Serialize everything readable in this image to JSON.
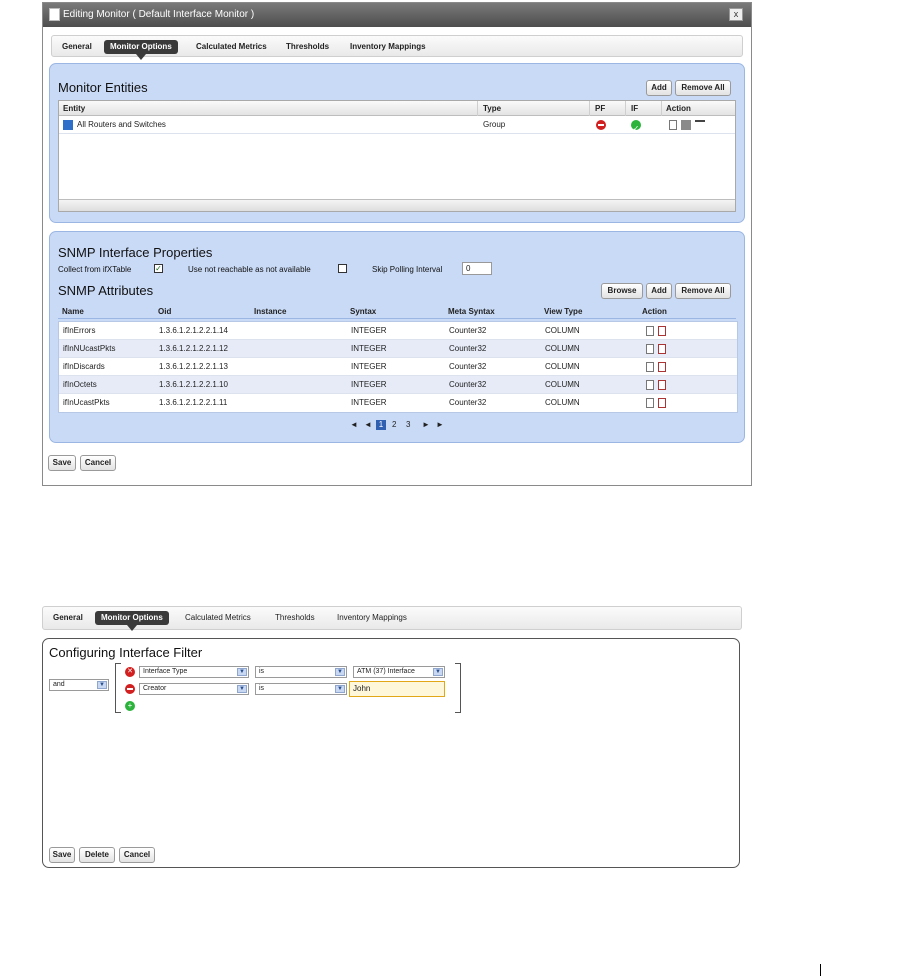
{
  "window1": {
    "title": "Editing Monitor ( Default Interface Monitor )",
    "close_label": "x",
    "tabs": [
      {
        "label": "General"
      },
      {
        "label": "Monitor Options"
      },
      {
        "label": "Calculated Metrics"
      },
      {
        "label": "Thresholds"
      },
      {
        "label": "Inventory Mappings"
      }
    ],
    "monitor_entities": {
      "title": "Monitor Entities",
      "add_label": "Add",
      "remove_all_label": "Remove All",
      "columns": [
        "Entity",
        "Type",
        "PF",
        "IF",
        "Action"
      ],
      "rows": [
        {
          "entity": "All Routers and Switches",
          "type": "Group"
        }
      ]
    },
    "snmp": {
      "title": "SNMP Interface Properties",
      "collect_label": "Collect from ifXTable",
      "collect_checked": "✓",
      "unreachable_label": "Use not reachable as not available",
      "skip_label": "Skip Polling Interval",
      "skip_value": "0",
      "attributes_title": "SNMP Attributes",
      "browse_label": "Browse",
      "add_label": "Add",
      "remove_all_label": "Remove All",
      "columns": [
        "Name",
        "Oid",
        "Instance",
        "Syntax",
        "Meta Syntax",
        "View Type",
        "Action"
      ],
      "rows": [
        {
          "name": "ifInErrors",
          "oid": "1.3.6.1.2.1.2.2.1.14",
          "instance": "",
          "syntax": "INTEGER",
          "meta": "Counter32",
          "view": "COLUMN"
        },
        {
          "name": "ifInNUcastPkts",
          "oid": "1.3.6.1.2.1.2.2.1.12",
          "instance": "",
          "syntax": "INTEGER",
          "meta": "Counter32",
          "view": "COLUMN"
        },
        {
          "name": "ifInDiscards",
          "oid": "1.3.6.1.2.1.2.2.1.13",
          "instance": "",
          "syntax": "INTEGER",
          "meta": "Counter32",
          "view": "COLUMN"
        },
        {
          "name": "ifInOctets",
          "oid": "1.3.6.1.2.1.2.2.1.10",
          "instance": "",
          "syntax": "INTEGER",
          "meta": "Counter32",
          "view": "COLUMN"
        },
        {
          "name": "ifInUcastPkts",
          "oid": "1.3.6.1.2.1.2.2.1.11",
          "instance": "",
          "syntax": "INTEGER",
          "meta": "Counter32",
          "view": "COLUMN"
        }
      ],
      "pager": {
        "first": "◄",
        "prev": "◄",
        "pages": [
          "1",
          "2",
          "3"
        ],
        "next": "►",
        "last": "►"
      }
    },
    "save_label": "Save",
    "cancel_label": "Cancel"
  },
  "window2": {
    "tabs": [
      {
        "label": "General"
      },
      {
        "label": "Monitor Options"
      },
      {
        "label": "Calculated Metrics"
      },
      {
        "label": "Thresholds"
      },
      {
        "label": "Inventory Mappings"
      }
    ],
    "title": "Configuring Interface Filter",
    "operator": "and",
    "filters": [
      {
        "field": "Interface Type",
        "op": "is",
        "value": "ATM (37) Interface"
      },
      {
        "field": "Creator",
        "op": "is",
        "value": "John"
      }
    ],
    "save_label": "Save",
    "delete_label": "Delete",
    "cancel_label": "Cancel"
  },
  "colors": {
    "panel": "#c9daf6",
    "active_tab": "#3a3a3a",
    "row_alt": "#e6ebf7",
    "highlight_input": "#fff7d9"
  }
}
